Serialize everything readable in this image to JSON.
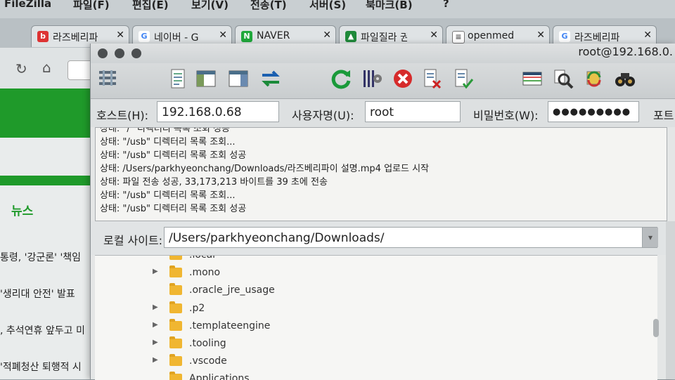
{
  "menubar": {
    "app": "FileZilla",
    "items": [
      "파일(F)",
      "편집(E)",
      "보기(V)",
      "전송(T)",
      "서버(S)",
      "북마크(B)",
      "?"
    ]
  },
  "tabs": [
    {
      "label": "라즈베리파",
      "favicon": "naver-blog-icon",
      "color": "#d33"
    },
    {
      "label": "네이버 - G",
      "favicon": "google-icon",
      "color": "#4285f4"
    },
    {
      "label": "NAVER",
      "favicon": "naver-n-icon",
      "color": "#1fa83b"
    },
    {
      "label": "파일질라 권",
      "favicon": "cap-icon",
      "color": "#1f8a3a"
    },
    {
      "label": "openmed",
      "favicon": "doc-icon",
      "color": "#777"
    },
    {
      "label": "라즈베리파",
      "favicon": "google-icon",
      "color": "#4285f4"
    }
  ],
  "browser": {
    "news_tab": "뉴스",
    "headlines": [
      "통령, '강군론' '책임",
      "'생리대 안전' 발표",
      ", 추석연휴 앞두고 미",
      "'적폐청산 퇴행적 시"
    ]
  },
  "window": {
    "title": "root@192.168.0."
  },
  "quickconnect": {
    "host_label": "호스트(H):",
    "host_value": "192.168.0.68",
    "user_label": "사용자명(U):",
    "user_value": "root",
    "pass_label": "비밀번호(W):",
    "pass_value": "●●●●●●●●●",
    "port_label": "포트"
  },
  "log": [
    "상태:  \"/\" 디렉터리 목록 조회 성공",
    "상태:  \"/usb\" 디렉터리 목록 조회...",
    "상태:  \"/usb\" 디렉터리 목록 조회 성공",
    "상태:  /Users/parkhyeonchang/Downloads/라즈베리파이 설명.mp4 업로드 시작",
    "상태:  파일 전송 성공, 33,173,213 바이트를 39 초에 전송",
    "상태:  \"/usb\" 디렉터리 목록 조회...",
    "상태:  \"/usb\" 디렉터리 목록 조회 성공"
  ],
  "local_site": {
    "label": "로컬 사이트:",
    "path": "/Users/parkhyeonchang/Downloads/"
  },
  "tree": [
    {
      "name": ".local",
      "arrow": false
    },
    {
      "name": ".mono",
      "arrow": true
    },
    {
      "name": ".oracle_jre_usage",
      "arrow": false
    },
    {
      "name": ".p2",
      "arrow": true
    },
    {
      "name": ".templateengine",
      "arrow": true
    },
    {
      "name": ".tooling",
      "arrow": true
    },
    {
      "name": ".vscode",
      "arrow": true
    },
    {
      "name": "Applications",
      "arrow": false
    }
  ]
}
